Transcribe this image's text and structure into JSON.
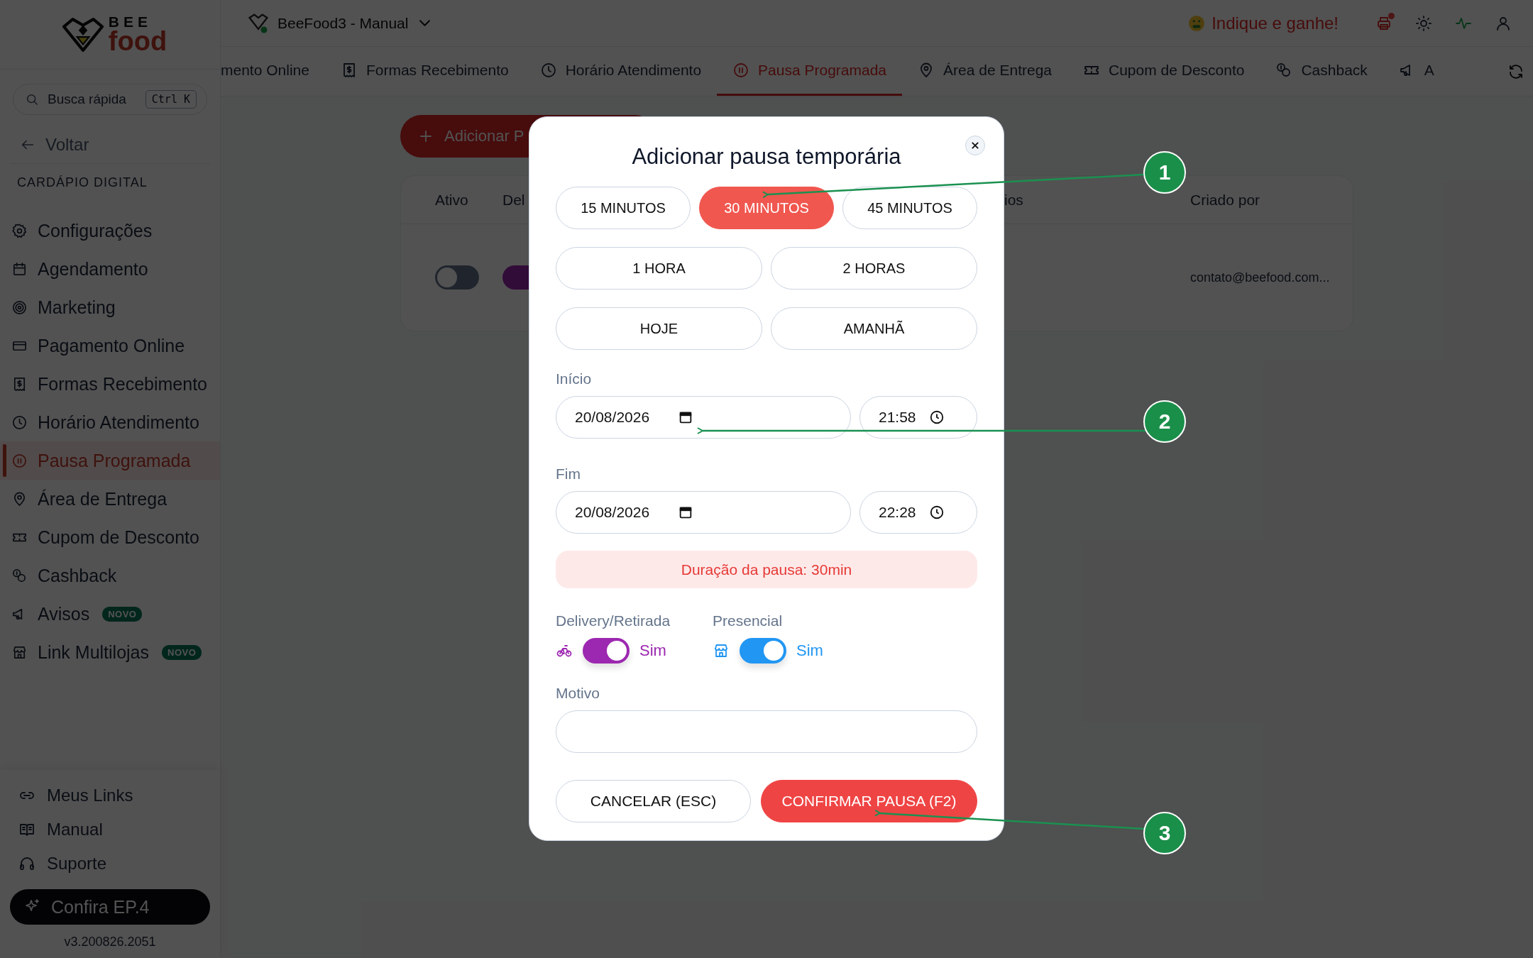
{
  "sidebar": {
    "logo": {
      "line1": "BEE",
      "line2": "food"
    },
    "search": {
      "placeholder": "Busca rápida",
      "shortcut": "Ctrl K"
    },
    "back": "Voltar",
    "section": "CARDÁPIO DIGITAL",
    "items": [
      {
        "label": "Configurações",
        "selected": false
      },
      {
        "label": "Agendamento",
        "selected": false
      },
      {
        "label": "Marketing",
        "selected": false
      },
      {
        "label": "Pagamento Online",
        "selected": false
      },
      {
        "label": "Formas Recebimento",
        "selected": false
      },
      {
        "label": "Horário Atendimento",
        "selected": false
      },
      {
        "label": "Pausa Programada",
        "selected": true
      },
      {
        "label": "Área de Entrega",
        "selected": false
      },
      {
        "label": "Cupom de Desconto",
        "selected": false
      },
      {
        "label": "Cashback",
        "selected": false
      },
      {
        "label": "Avisos",
        "selected": false,
        "badge": "NOVO"
      },
      {
        "label": "Link Multilojas",
        "selected": false,
        "badge": "NOVO"
      }
    ],
    "footer_links": [
      "Meus Links",
      "Manual",
      "Suporte"
    ],
    "promo_button": "Confira EP.4",
    "version": "v3.200826.2051"
  },
  "topbar": {
    "store": "BeeFood3 - Manual",
    "referral": "Indique e ganhe!"
  },
  "tabs": [
    {
      "label": "mento Online",
      "selected": false
    },
    {
      "label": "Formas Recebimento",
      "selected": false
    },
    {
      "label": "Horário Atendimento",
      "selected": false
    },
    {
      "label": "Pausa Programada",
      "selected": true
    },
    {
      "label": "Área de Entrega",
      "selected": false
    },
    {
      "label": "Cupom de Desconto",
      "selected": false
    },
    {
      "label": "Cashback",
      "selected": false
    },
    {
      "label": "A",
      "selected": false
    }
  ],
  "page": {
    "add_button": "Adicionar P",
    "table": {
      "columns": [
        "Ativo",
        "Del",
        "ios",
        "Criado por"
      ],
      "rows": [
        {
          "active": false,
          "created_by": "contato@beefood.com..."
        }
      ]
    }
  },
  "dialog": {
    "title": "Adicionar pausa temporária",
    "presets": [
      [
        {
          "label": "15 MINUTOS",
          "selected": false
        },
        {
          "label": "30 MINUTOS",
          "selected": true
        },
        {
          "label": "45 MINUTOS",
          "selected": false
        }
      ],
      [
        {
          "label": "1 HORA",
          "selected": false
        },
        {
          "label": "2 HORAS",
          "selected": false
        }
      ],
      [
        {
          "label": "HOJE",
          "selected": false
        },
        {
          "label": "AMANHÃ",
          "selected": false
        }
      ]
    ],
    "start": {
      "label": "Início",
      "date": "20/08/2026",
      "time": "21:58"
    },
    "end": {
      "label": "Fim",
      "date": "20/08/2026",
      "time": "22:28"
    },
    "duration": "Duração da pausa: 30min",
    "channels": [
      {
        "label": "Delivery/Retirada",
        "on": true,
        "value_label": "Sim",
        "color": "#9c27b0"
      },
      {
        "label": "Presencial",
        "on": true,
        "value_label": "Sim",
        "color": "#2196f3"
      }
    ],
    "reason": {
      "label": "Motivo"
    },
    "buttons": [
      {
        "label": "CANCELAR (ESC)",
        "kind": "secondary"
      },
      {
        "label": "CONFIRMAR PAUSA (F2)",
        "kind": "primary"
      }
    ]
  },
  "annotations": [
    {
      "number": "1"
    },
    {
      "number": "2"
    },
    {
      "number": "3"
    }
  ]
}
